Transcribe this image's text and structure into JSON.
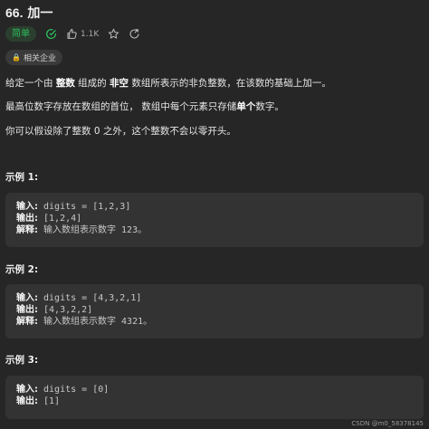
{
  "problem": {
    "number": "66.",
    "title": "加一",
    "difficulty": "简单",
    "likes": "1.1K"
  },
  "tag": {
    "label": "相关企业"
  },
  "description": {
    "p1_a": "给定一个由 ",
    "p1_b": "整数",
    "p1_c": " 组成的 ",
    "p1_d": "非空",
    "p1_e": " 数组所表示的非负整数，在该数的基础上加一。",
    "p2_a": "最高位数字存放在数组的首位， 数组中每个元素只存储",
    "p2_b": "单个",
    "p2_c": "数字。",
    "p3": "你可以假设除了整数 0 之外，这个整数不会以零开头。"
  },
  "examples": [
    {
      "title": "示例 1:",
      "input_key": "输入:",
      "input_val": " digits = [1,2,3]",
      "output_key": "输出:",
      "output_val": " [1,2,4]",
      "explain_key": "解释:",
      "explain_val": " 输入数组表示数字 123。"
    },
    {
      "title": "示例 2:",
      "input_key": "输入:",
      "input_val": " digits = [4,3,2,1]",
      "output_key": "输出:",
      "output_val": " [4,3,2,2]",
      "explain_key": "解释:",
      "explain_val": " 输入数组表示数字 4321。"
    },
    {
      "title": "示例 3:",
      "input_key": "输入:",
      "input_val": " digits = [0]",
      "output_key": "输出:",
      "output_val": " [1]"
    }
  ],
  "watermark": "CSDN @m0_58378145",
  "colors": {
    "background": "#262626",
    "difficulty_easy": "#2cbb5d",
    "code_box": "#333333"
  },
  "icons": [
    "check-circle-icon",
    "thumbs-up-icon",
    "star-icon",
    "share-icon",
    "lock-icon"
  ]
}
